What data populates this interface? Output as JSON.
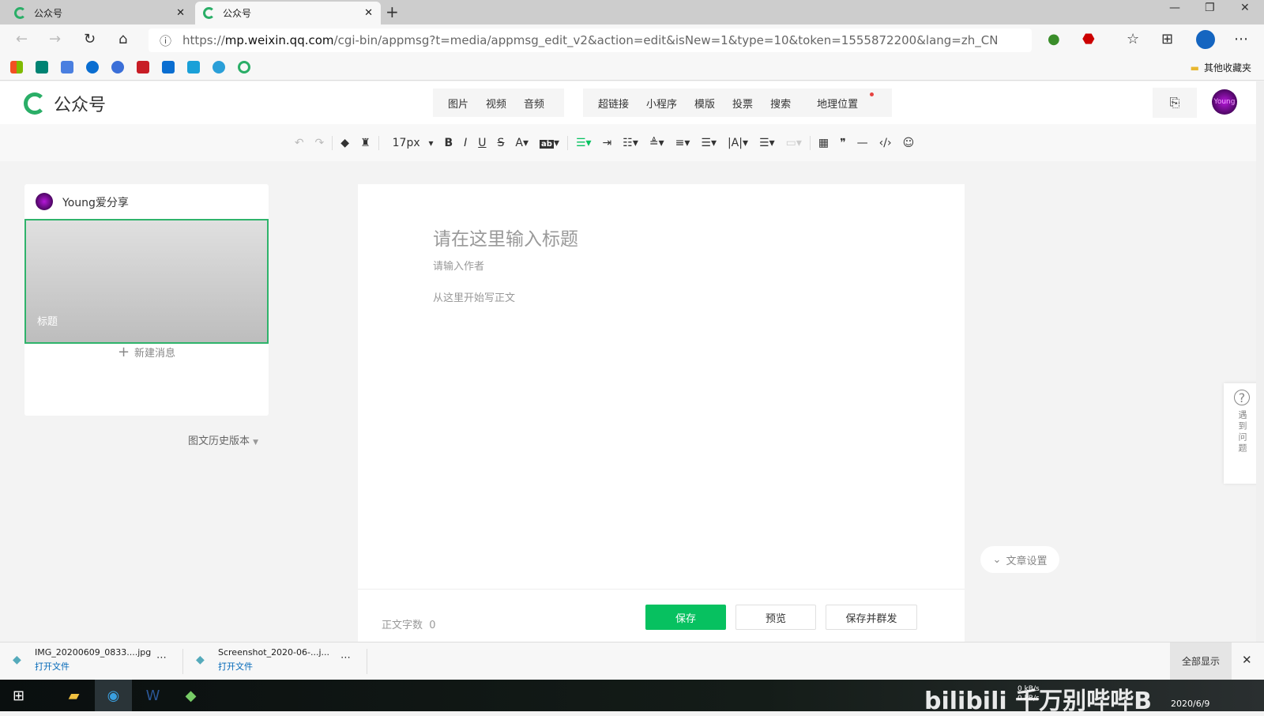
{
  "browser": {
    "tabs": [
      {
        "title": "公众号"
      },
      {
        "title": "公众号",
        "active": true
      }
    ],
    "url_prefix": "https://",
    "url_host": "mp.weixin.qq.com",
    "url_path": "/cgi-bin/appmsg?t=media/appmsg_edit_v2&action=edit&isNew=1&type=10&token=1555872200&lang=zh_CN",
    "other_bookmarks": "其他收藏夹",
    "bookmark_colors": [
      "#f25022",
      "#008373",
      "#4a7fe0",
      "#0a6ed1",
      "#3b6fd8",
      "#c81d25",
      "#0a6ed1",
      "#1aa0d8",
      "#2a9fd8",
      "#2aae67"
    ]
  },
  "header": {
    "logo": "公众号",
    "menu_media": [
      "图片",
      "视频",
      "音频"
    ],
    "menu_tools": [
      "超链接",
      "小程序",
      "模版",
      "投票",
      "搜索",
      "地理位置"
    ],
    "avatar": "Young"
  },
  "toolbar": {
    "font_size": "17px"
  },
  "left": {
    "account_name": "Young爱分享",
    "cover_title": "标题",
    "new_message": "新建消息",
    "history": "图文历史版本"
  },
  "editor": {
    "title_placeholder": "请在这里输入标题",
    "author_placeholder": "请输入作者",
    "body_placeholder": "从这里开始写正文",
    "word_count_label": "正文字数",
    "word_count": "0",
    "save": "保存",
    "preview": "预览",
    "save_send": "保存并群发"
  },
  "article_settings": "文章设置",
  "help": "遇到问题",
  "downloads": [
    {
      "name": "IMG_20200609_0833....jpg",
      "action": "打开文件"
    },
    {
      "name": "Screenshot_2020-06-...j...",
      "action": "打开文件"
    }
  ],
  "show_all": "全部显示",
  "taskbar": {
    "date": "2020/6/9",
    "net_up": "0 kB/s",
    "net_down": "0 kB/s"
  },
  "watermark": "bilibili 千万别哔哔B"
}
